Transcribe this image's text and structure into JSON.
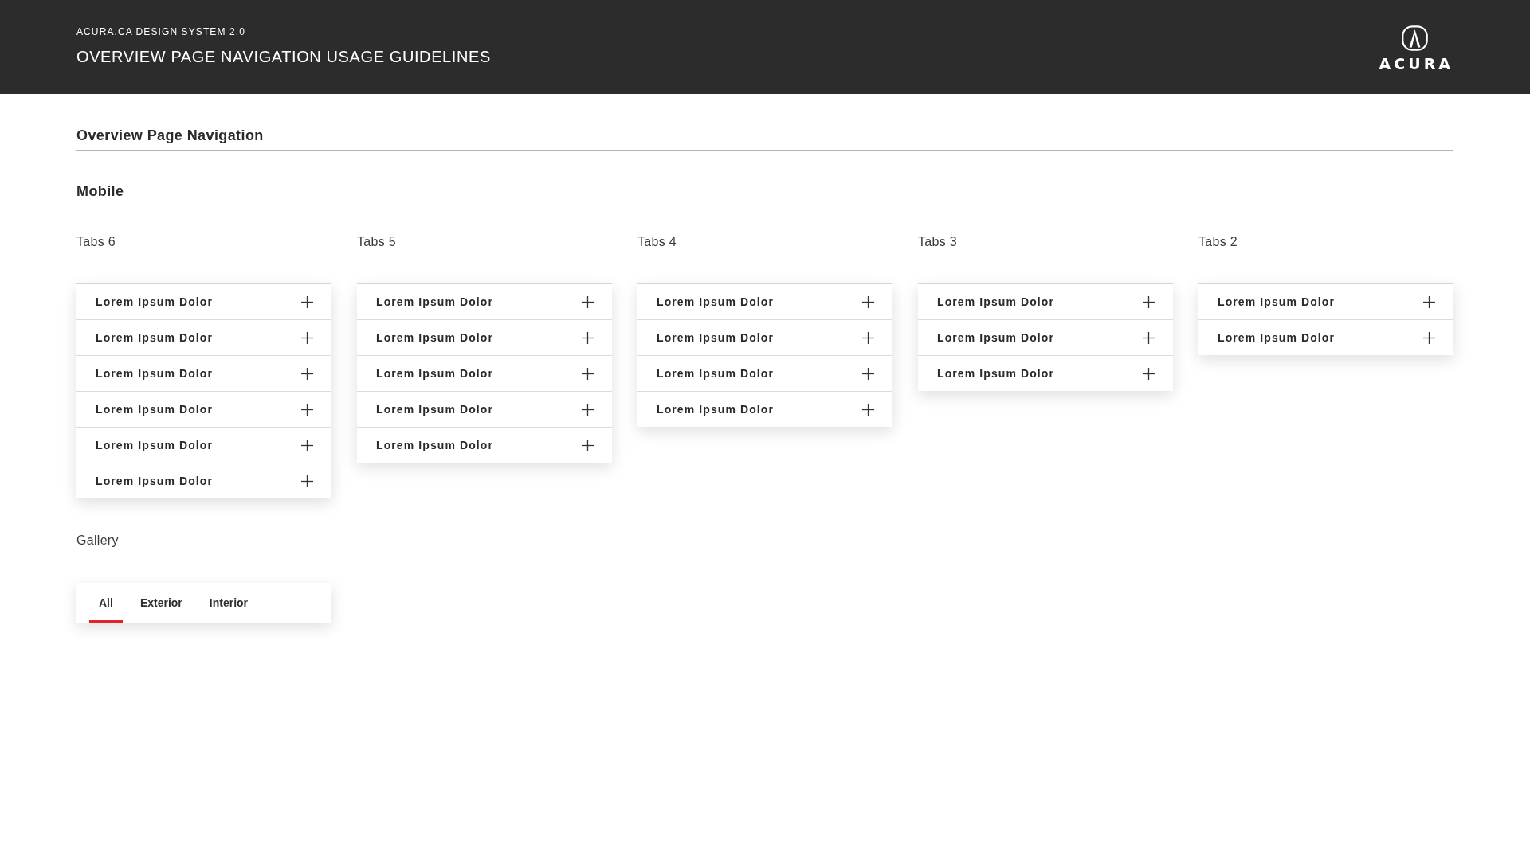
{
  "header": {
    "subtitle": "ACURA.CA DESIGN SYSTEM 2.0",
    "title": "OVERVIEW PAGE NAVIGATION USAGE GUIDELINES",
    "logo": {
      "wordmark": "ACURA"
    }
  },
  "page_section": {
    "title": "Overview Page Navigation"
  },
  "mobile": {
    "heading": "Mobile",
    "tab_groups": [
      {
        "label": "Tabs 6",
        "items": [
          {
            "label": "Lorem Ipsum Dolor",
            "expanded": false
          },
          {
            "label": "Lorem Ipsum Dolor",
            "expanded": false
          },
          {
            "label": "Lorem Ipsum Dolor",
            "expanded": false
          },
          {
            "label": "Lorem Ipsum Dolor",
            "expanded": false
          },
          {
            "label": "Lorem Ipsum Dolor",
            "expanded": false
          },
          {
            "label": "Lorem Ipsum Dolor",
            "expanded": false
          }
        ]
      },
      {
        "label": "Tabs 5",
        "items": [
          {
            "label": "Lorem Ipsum Dolor",
            "expanded": false
          },
          {
            "label": "Lorem Ipsum Dolor",
            "expanded": false
          },
          {
            "label": "Lorem Ipsum Dolor",
            "expanded": false
          },
          {
            "label": "Lorem Ipsum Dolor",
            "expanded": false
          },
          {
            "label": "Lorem Ipsum Dolor",
            "expanded": false
          }
        ]
      },
      {
        "label": "Tabs 4",
        "items": [
          {
            "label": "Lorem Ipsum Dolor",
            "expanded": false
          },
          {
            "label": "Lorem Ipsum Dolor",
            "expanded": false
          },
          {
            "label": "Lorem Ipsum Dolor",
            "expanded": false
          },
          {
            "label": "Lorem Ipsum Dolor",
            "expanded": false
          }
        ]
      },
      {
        "label": "Tabs 3",
        "items": [
          {
            "label": "Lorem Ipsum Dolor",
            "expanded": false
          },
          {
            "label": "Lorem Ipsum Dolor",
            "expanded": false
          },
          {
            "label": "Lorem Ipsum Dolor",
            "expanded": false
          }
        ]
      },
      {
        "label": "Tabs 2",
        "items": [
          {
            "label": "Lorem Ipsum Dolor",
            "expanded": false
          },
          {
            "label": "Lorem Ipsum Dolor",
            "expanded": false
          }
        ]
      }
    ]
  },
  "gallery": {
    "label": "Gallery",
    "tabs": [
      {
        "label": "All",
        "selected": true
      },
      {
        "label": "Exterior",
        "selected": false
      },
      {
        "label": "Interior",
        "selected": false
      }
    ]
  }
}
